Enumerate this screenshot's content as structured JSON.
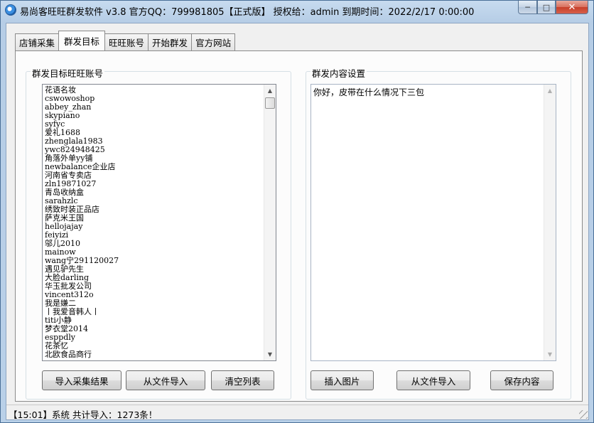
{
  "window": {
    "title": "易尚客旺旺群发软件 v3.8 官方QQ：799981805【正式版】 授权给：admin  到期时间：2022/2/17 0:00:00",
    "controls": {
      "minimize": "─",
      "maximize": "□",
      "close": "✕"
    }
  },
  "tabs": [
    {
      "label": "店铺采集",
      "active": false
    },
    {
      "label": "群发目标",
      "active": true
    },
    {
      "label": "旺旺账号",
      "active": false
    },
    {
      "label": "开始群发",
      "active": false
    },
    {
      "label": "官方网站",
      "active": false
    }
  ],
  "target_group": {
    "title": "群发目标旺旺账号",
    "accounts": [
      "花语名妆",
      "cswowoshop",
      "abbey_zhan",
      "skypiano",
      "syfyc",
      "爱礼1688",
      "zhenglala1983",
      "ywc824948425",
      "角落外单yy铺",
      "newbalance企业店",
      "河南省专卖店",
      "zln19871027",
      "青岛收纳盒",
      "sarahzlc",
      "绣致时装正品店",
      "萨克米王国",
      "hellojajay",
      "feiyizi",
      "邬儿2010",
      "mainow",
      "wang宁291120027",
      "遇见驴先生",
      "大脸darling",
      "华玉批发公司",
      "vincent312o",
      "我是嫌二",
      "丨我爱音韩人丨",
      "titi小静",
      "梦衣堂2014",
      "esppdly",
      "花茶忆",
      "北欧食品商行"
    ],
    "buttons": {
      "import_results": "导入采集结果",
      "import_file": "从文件导入",
      "clear": "清空列表"
    }
  },
  "content_group": {
    "title": "群发内容设置",
    "message": "你好，皮带在什么情况下三包",
    "buttons": {
      "insert_image": "插入图片",
      "import_file": "从文件导入",
      "save": "保存内容"
    }
  },
  "status": {
    "text": "【15:01】系统 共计导入：1273条！"
  },
  "scroll_glyphs": {
    "up": "▲",
    "down": "▼"
  }
}
